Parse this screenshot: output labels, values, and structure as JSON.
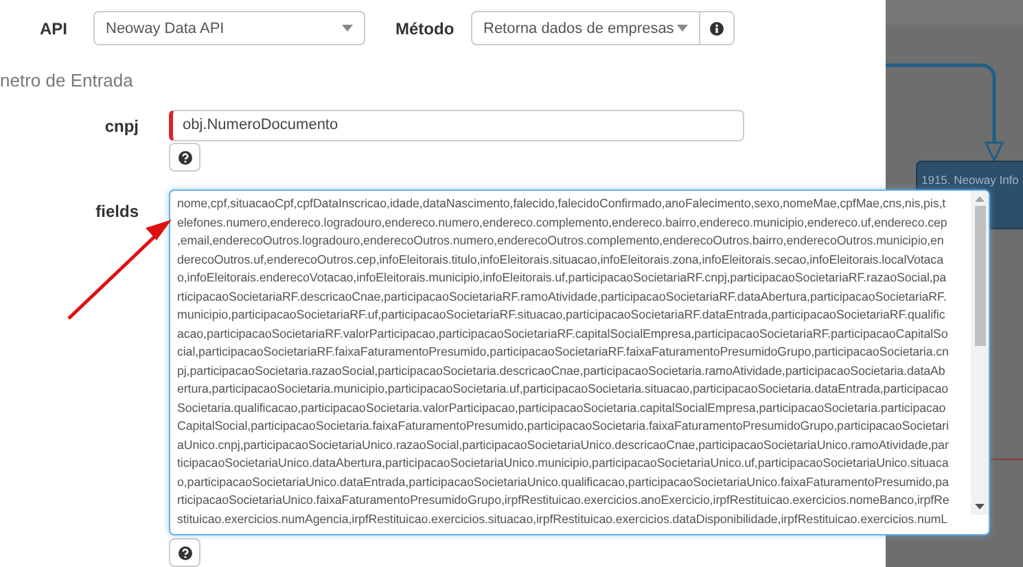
{
  "api": {
    "label": "API",
    "value": "Neoway Data API"
  },
  "method": {
    "label": "Método",
    "value": "Retorna dados de empresas"
  },
  "section_title": "netro de Entrada",
  "params": [
    {
      "kind": "input",
      "label": "cnpj",
      "invalid": true,
      "value": "obj.NumeroDocumento"
    },
    {
      "kind": "textarea",
      "label": "fields",
      "focused": true,
      "lines": [
        "nome,cpf,situacaoCpf,cpfDataInscricao,idade,dataNascimento,falecido,falecidoConfirmado,anoFalecimento,sexo,nomeMae,cpfMae,cns,nis,pis,t",
        "elefones.numero,endereco.logradouro,endereco.numero,endereco.complemento,endereco.bairro,endereco.municipio,endereco.uf,endereco.cep",
        ",email,enderecoOutros.logradouro,enderecoOutros.numero,enderecoOutros.complemento,enderecoOutros.bairro,enderecoOutros.municipio,en",
        "derecoOutros.uf,enderecoOutros.cep,infoEleitorais.titulo,infoEleitorais.situacao,infoEleitorais.zona,infoEleitorais.secao,infoEleitorais.localVotaca",
        "o,infoEleitorais.enderecoVotacao,infoEleitorais.municipio,infoEleitorais.uf,participacaoSocietariaRF.cnpj,participacaoSocietariaRF.razaoSocial,pa",
        "rticipacaoSocietariaRF.descricaoCnae,participacaoSocietariaRF.ramoAtividade,participacaoSocietariaRF.dataAbertura,participacaoSocietariaRF.",
        "municipio,participacaoSocietariaRF.uf,participacaoSocietariaRF.situacao,participacaoSocietariaRF.dataEntrada,participacaoSocietariaRF.qualific",
        "acao,participacaoSocietariaRF.valorParticipacao,participacaoSocietariaRF.capitalSocialEmpresa,participacaoSocietariaRF.participacaoCapitalSo",
        "cial,participacaoSocietariaRF.faixaFaturamentoPresumido,participacaoSocietariaRF.faixaFaturamentoPresumidoGrupo,participacaoSocietaria.cn",
        "pj,participacaoSocietaria.razaoSocial,participacaoSocietaria.descricaoCnae,participacaoSocietaria.ramoAtividade,participacaoSocietaria.dataAb",
        "ertura,participacaoSocietaria.municipio,participacaoSocietaria.uf,participacaoSocietaria.situacao,participacaoSocietaria.dataEntrada,participacao",
        "Societaria.qualificacao,participacaoSocietaria.valorParticipacao,participacaoSocietaria.capitalSocialEmpresa,participacaoSocietaria.participacao",
        "CapitalSocial,participacaoSocietaria.faixaFaturamentoPresumido,participacaoSocietaria.faixaFaturamentoPresumidoGrupo,participacaoSocietari",
        "aUnico.cnpj,participacaoSocietariaUnico.razaoSocial,participacaoSocietariaUnico.descricaoCnae,participacaoSocietariaUnico.ramoAtividade,par",
        "ticipacaoSocietariaUnico.dataAbertura,participacaoSocietariaUnico.municipio,participacaoSocietariaUnico.uf,participacaoSocietariaUnico.situaca",
        "o,participacaoSocietariaUnico.dataEntrada,participacaoSocietariaUnico.qualificacao,participacaoSocietariaUnico.faixaFaturamentoPresumido,pa",
        "rticipacaoSocietariaUnico.faixaFaturamentoPresumidoGrupo,irpfRestituicao.exercicios.anoExercicio,irpfRestituicao.exercicios.nomeBanco,irpfRe",
        "stituicao.exercicios.numAgencia,irpfRestituicao.exercicios.situacao,irpfRestituicao.exercicios.dataDisponibilidade,irpfRestituicao.exercicios.numL"
      ]
    }
  ],
  "flow_node": {
    "label": "1915. Neoway Info"
  }
}
